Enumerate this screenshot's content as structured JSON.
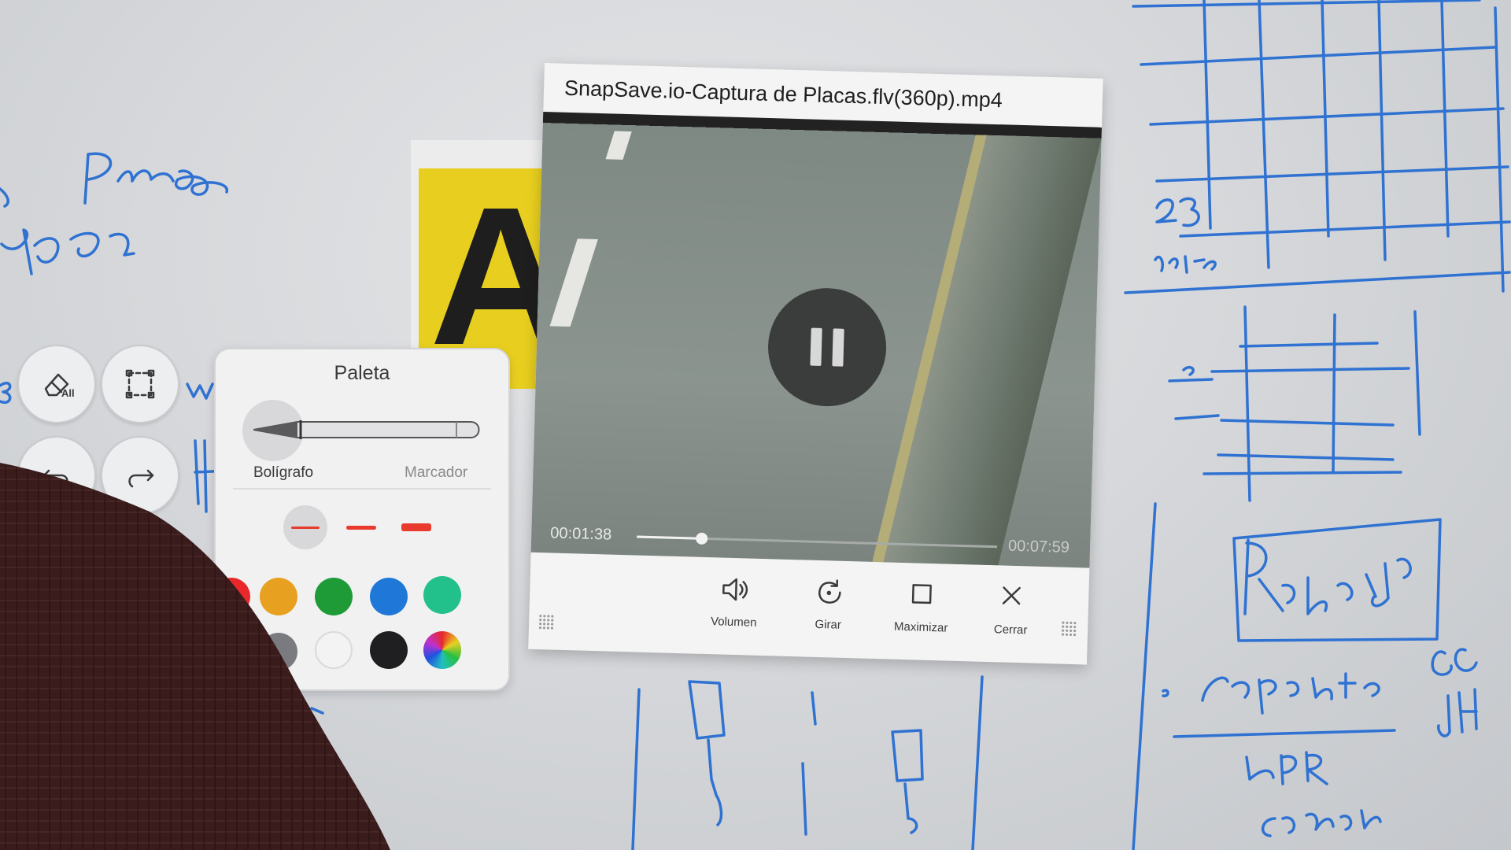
{
  "video_player": {
    "title": "SnapSave.io-Captura de Placas.flv(360p).mp4",
    "current_time": "00:01:38",
    "total_time": "00:07:59",
    "progress": 0.18,
    "state": "playing",
    "controls": {
      "volume": "Volumen",
      "rotate": "Girar",
      "maximize": "Maximizar",
      "close": "Cerrar"
    }
  },
  "palette": {
    "title": "Paleta",
    "pen_label": "Bolígrafo",
    "marker_label": "Marcador",
    "selected_tool": "pen",
    "selected_thickness": 1,
    "colors": [
      "#e8282a",
      "#e8a021",
      "#1e9a36",
      "#1f78d8",
      "#22c08a",
      "#7a7b7e",
      "#f3f3f3",
      "#1f1f21",
      "rainbow"
    ]
  },
  "whiteboard_tools": {
    "erase_all_label": "All"
  },
  "background_image": {
    "plate_text": "AZ"
  },
  "colors": {
    "ink": "#2f72d2",
    "palette_bg": "#f1f1f2",
    "accent_red": "#e83a2d"
  }
}
